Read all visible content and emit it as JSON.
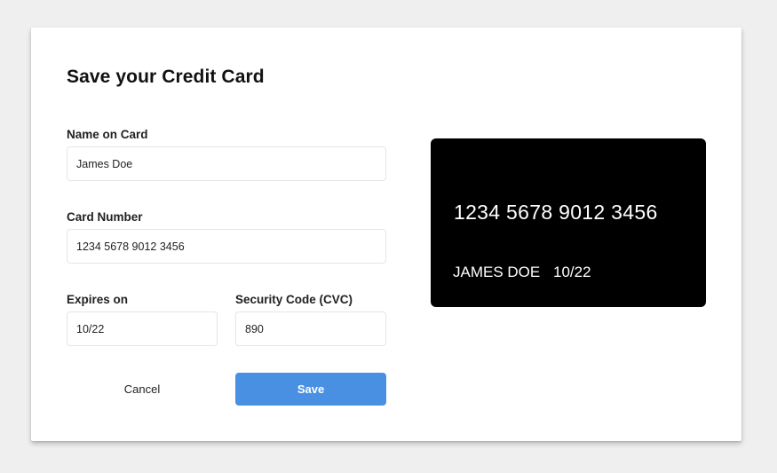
{
  "dialog": {
    "title": "Save your Credit Card"
  },
  "form": {
    "name": {
      "label": "Name on Card",
      "value": "James Doe",
      "placeholder": ""
    },
    "number": {
      "label": "Card Number",
      "value": "1234 5678 9012 3456",
      "placeholder": ""
    },
    "expiry": {
      "label": "Expires on",
      "value": "10/22",
      "placeholder": ""
    },
    "cvc": {
      "label": "Security Code (CVC)",
      "value": "890",
      "placeholder": ""
    }
  },
  "actions": {
    "cancel_label": "Cancel",
    "save_label": "Save"
  },
  "card_preview": {
    "number": "1234 5678 9012 3456",
    "holder": "JAMES DOE",
    "expiry": "10/22"
  },
  "colors": {
    "accent": "#4a90e2",
    "card_background": "#000000",
    "page_background": "#efefef"
  }
}
